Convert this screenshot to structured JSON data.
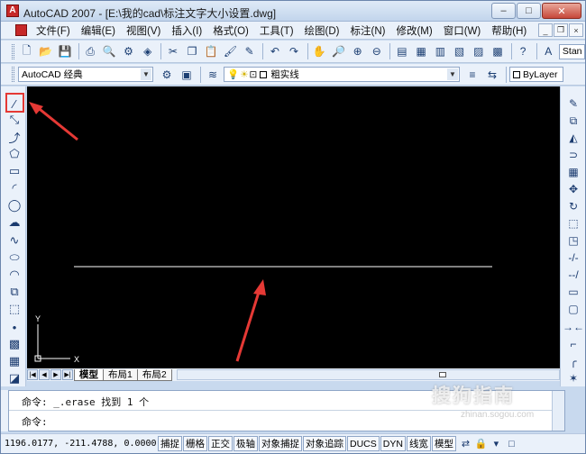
{
  "window": {
    "title": "AutoCAD 2007 - [E:\\我的cad\\标注文字大小设置.dwg]",
    "app_icon": "autocad-logo-icon",
    "controls": {
      "minimize": "–",
      "maximize": "□",
      "close": "✕"
    }
  },
  "menu": {
    "items": [
      "文件(F)",
      "编辑(E)",
      "视图(V)",
      "插入(I)",
      "格式(O)",
      "工具(T)",
      "绘图(D)",
      "标注(N)",
      "修改(M)",
      "窗口(W)",
      "帮助(H)"
    ],
    "doc_controls": {
      "minimize": "_",
      "restore": "❐",
      "close": "×"
    }
  },
  "toolbar_standard": {
    "text_style_value": "Stan"
  },
  "toolbar_workspace": {
    "workspace_value": "AutoCAD 经典",
    "layer_value": "粗实线",
    "color_value": "ByLayer"
  },
  "canvas": {
    "background": "#000000",
    "line_color": "#ffffff",
    "ucs_x_label": "X",
    "ucs_y_label": "Y"
  },
  "annotations": {
    "arrow_color": "#e53935",
    "highlight_color": "#e53935"
  },
  "layout_tabs": {
    "tabs": [
      "模型",
      "布局1",
      "布局2"
    ],
    "active": "模型"
  },
  "command": {
    "line1": "命令: _.erase 找到 1 个",
    "line2": "命令:"
  },
  "status": {
    "coordinates": "1196.0177, -211.4788, 0.0000",
    "toggles": [
      "捕捉",
      "栅格",
      "正交",
      "极轴",
      "对象捕捉",
      "对象追踪",
      "DUCS",
      "DYN",
      "线宽",
      "模型"
    ]
  },
  "watermark": {
    "text": "搜狗指南",
    "sub": "zhinan.sogou.com"
  }
}
